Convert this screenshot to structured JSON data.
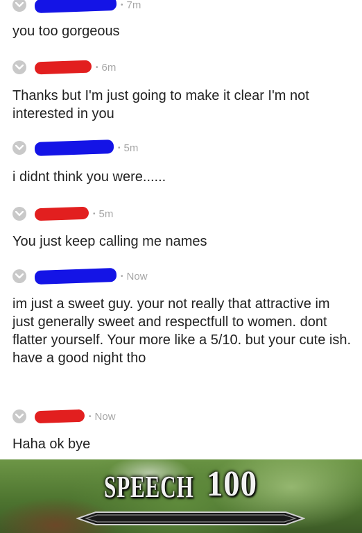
{
  "thread": {
    "comments": [
      {
        "time": "7m",
        "text": "you too gorgeous"
      },
      {
        "time": "6m",
        "text": "Thanks but I'm just going to make it clear I'm not interested in you"
      },
      {
        "time": "5m",
        "text": "i didnt think you were......"
      },
      {
        "time": "5m",
        "text": "You just keep calling me names"
      },
      {
        "time": "Now",
        "text": "im just a sweet guy. your not really that attractive im just generally sweet and respectfull to women. dont flatter yourself. Your more like a 5/10. but your cute ish. have a good night tho"
      },
      {
        "time": "Now",
        "text": "Haha ok bye"
      }
    ],
    "redaction_colors": {
      "blue": "#1414e6",
      "red": "#e21f1f"
    }
  },
  "meme": {
    "skill_word": "SPEECH",
    "skill_level": "100"
  },
  "icons": {
    "collapse": "chevron-down-icon"
  }
}
